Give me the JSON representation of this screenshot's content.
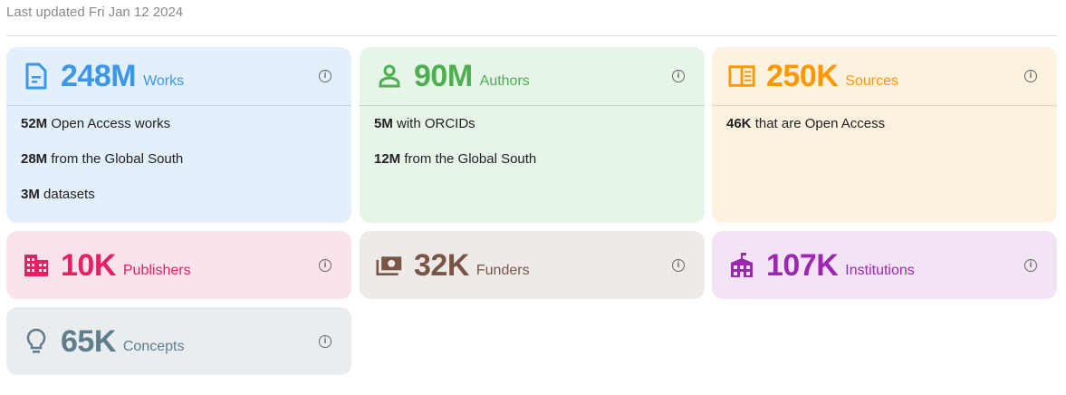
{
  "last_updated": "Last updated Fri Jan 12 2024",
  "cards": [
    {
      "id": "works",
      "count": "248M",
      "label": "Works",
      "icon": "document-icon",
      "color": "#3a97ea",
      "bg": "#e3effb",
      "details": [
        {
          "value": "52M",
          "text": " Open Access works"
        },
        {
          "value": "28M",
          "text": " from the Global South"
        },
        {
          "value": "3M",
          "text": " datasets"
        }
      ]
    },
    {
      "id": "authors",
      "count": "90M",
      "label": "Authors",
      "icon": "person-icon",
      "color": "#4caf50",
      "bg": "#e7f4e8",
      "details": [
        {
          "value": "5M",
          "text": " with ORCIDs"
        },
        {
          "value": "12M",
          "text": " from the Global South"
        }
      ]
    },
    {
      "id": "sources",
      "count": "250K",
      "label": "Sources",
      "icon": "book-open-icon",
      "color": "#ff9800",
      "bg": "#fdf1e0",
      "details": [
        {
          "value": "46K",
          "text": " that are Open Access"
        }
      ]
    },
    {
      "id": "publishers",
      "count": "10K",
      "label": "Publishers",
      "icon": "building-icon",
      "color": "#e91e63",
      "bg": "#fbe3ea"
    },
    {
      "id": "funders",
      "count": "32K",
      "label": "Funders",
      "icon": "money-icon",
      "color": "#795548",
      "bg": "#eeeae7"
    },
    {
      "id": "institutions",
      "count": "107K",
      "label": "Institutions",
      "icon": "school-icon",
      "color": "#9c27b0",
      "bg": "#f2e4f4"
    },
    {
      "id": "concepts",
      "count": "65K",
      "label": "Concepts",
      "icon": "lightbulb-icon",
      "color": "#607d8b",
      "bg": "#eaedf0"
    }
  ],
  "info_glyph": "i"
}
